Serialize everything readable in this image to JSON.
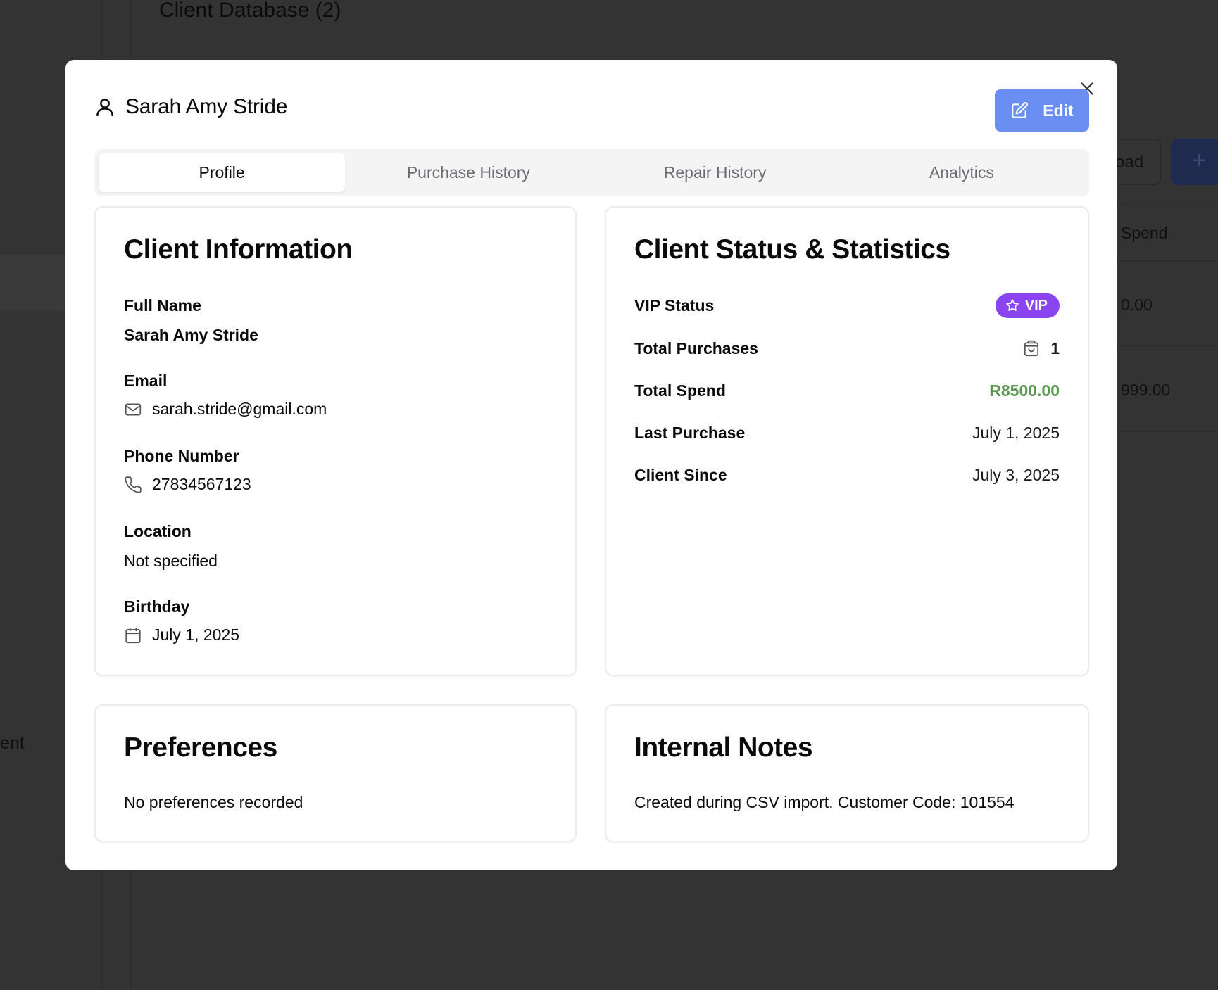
{
  "background": {
    "page_title": "Client Database (2)",
    "side_text": "ent",
    "button_partial": "oad",
    "add_symbol": "+",
    "column_partial": "Spend",
    "cells": [
      "0.00",
      "999.00"
    ]
  },
  "modal": {
    "client_name": "Sarah Amy Stride",
    "edit_label": "Edit",
    "tabs": [
      {
        "label": "Profile",
        "active": true
      },
      {
        "label": "Purchase History",
        "active": false
      },
      {
        "label": "Repair History",
        "active": false
      },
      {
        "label": "Analytics",
        "active": false
      }
    ],
    "client_info": {
      "title": "Client Information",
      "full_name_label": "Full Name",
      "full_name": "Sarah Amy Stride",
      "email_label": "Email",
      "email": "sarah.stride@gmail.com",
      "phone_label": "Phone Number",
      "phone": "27834567123",
      "location_label": "Location",
      "location": "Not specified",
      "birthday_label": "Birthday",
      "birthday": "July 1, 2025"
    },
    "status": {
      "title": "Client Status & Statistics",
      "vip_label": "VIP Status",
      "vip_value": "VIP",
      "purchases_label": "Total Purchases",
      "purchases_value": "1",
      "spend_label": "Total Spend",
      "spend_value": "R8500.00",
      "last_purchase_label": "Last Purchase",
      "last_purchase_value": "July 1, 2025",
      "since_label": "Client Since",
      "since_value": "July 3, 2025"
    },
    "preferences": {
      "title": "Preferences",
      "text": "No preferences recorded"
    },
    "notes": {
      "title": "Internal Notes",
      "text": "Created during CSV import. Customer Code: 101554"
    }
  },
  "colors": {
    "edit_button": "#6b8ef2",
    "vip_badge": "#8b45f0",
    "spend": "#5c9a52",
    "overlay": "#333333"
  },
  "icons": [
    "user-icon",
    "edit-icon",
    "close-icon",
    "mail-icon",
    "phone-icon",
    "calendar-icon",
    "star-icon",
    "shopping-bag-icon"
  ]
}
